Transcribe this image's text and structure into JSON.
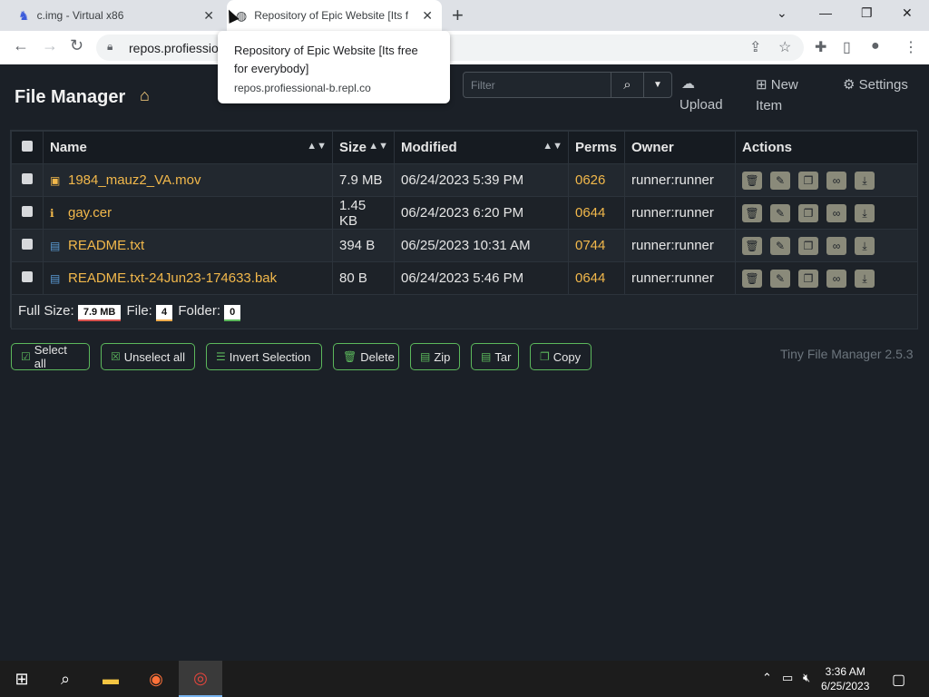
{
  "browser": {
    "tabs": [
      {
        "title": "c.img - Virtual x86"
      },
      {
        "title": "Repository of Epic Website [Its fr"
      }
    ],
    "url": "repos.profiessio",
    "tooltip": {
      "title": "Repository of Epic Website [Its free for everybody]",
      "url": "repos.profiessional-b.repl.co"
    }
  },
  "app": {
    "brand": "File Manager",
    "filter_placeholder": "Filter",
    "nav": {
      "upload": "Upload",
      "new_item_1": "New",
      "new_item_2": "Item",
      "settings": "Settings"
    }
  },
  "table": {
    "headers": {
      "name": "Name",
      "size": "Size",
      "modified": "Modified",
      "perms": "Perms",
      "owner": "Owner",
      "actions": "Actions"
    },
    "rows": [
      {
        "name": "1984_mauz2_VA.mov",
        "size": "7.9 MB",
        "modified": "06/24/2023 5:39 PM",
        "perms": "0626",
        "owner": "runner:runner",
        "icon": "video-file-icon"
      },
      {
        "name": "gay.cer",
        "size": "1.45 KB",
        "modified": "06/24/2023 6:20 PM",
        "perms": "0644",
        "owner": "runner:runner",
        "icon": "info-icon"
      },
      {
        "name": "README.txt",
        "size": "394 B",
        "modified": "06/25/2023 10:31 AM",
        "perms": "0744",
        "owner": "runner:runner",
        "icon": "text-file-icon"
      },
      {
        "name": "README.txt-24Jun23-174633.bak",
        "size": "80 B",
        "modified": "06/24/2023 5:46 PM",
        "perms": "0644",
        "owner": "runner:runner",
        "icon": "text-file-icon"
      }
    ],
    "footer": {
      "full_size_label": "Full Size:",
      "full_size": "7.9 MB",
      "file_label": "File:",
      "file_count": "4",
      "folder_label": "Folder:",
      "folder_count": "0"
    }
  },
  "buttons": {
    "select_all": "Select all",
    "unselect_all": "Unselect all",
    "invert": "Invert Selection",
    "delete": "Delete",
    "zip": "Zip",
    "tar": "Tar",
    "copy": "Copy"
  },
  "version": "Tiny File Manager 2.5.3",
  "taskbar": {
    "time": "3:36 AM",
    "date": "6/25/2023"
  },
  "colors": {
    "accent": "#5cb85c",
    "filename": "#f2b84b",
    "background": "#1b2027"
  }
}
